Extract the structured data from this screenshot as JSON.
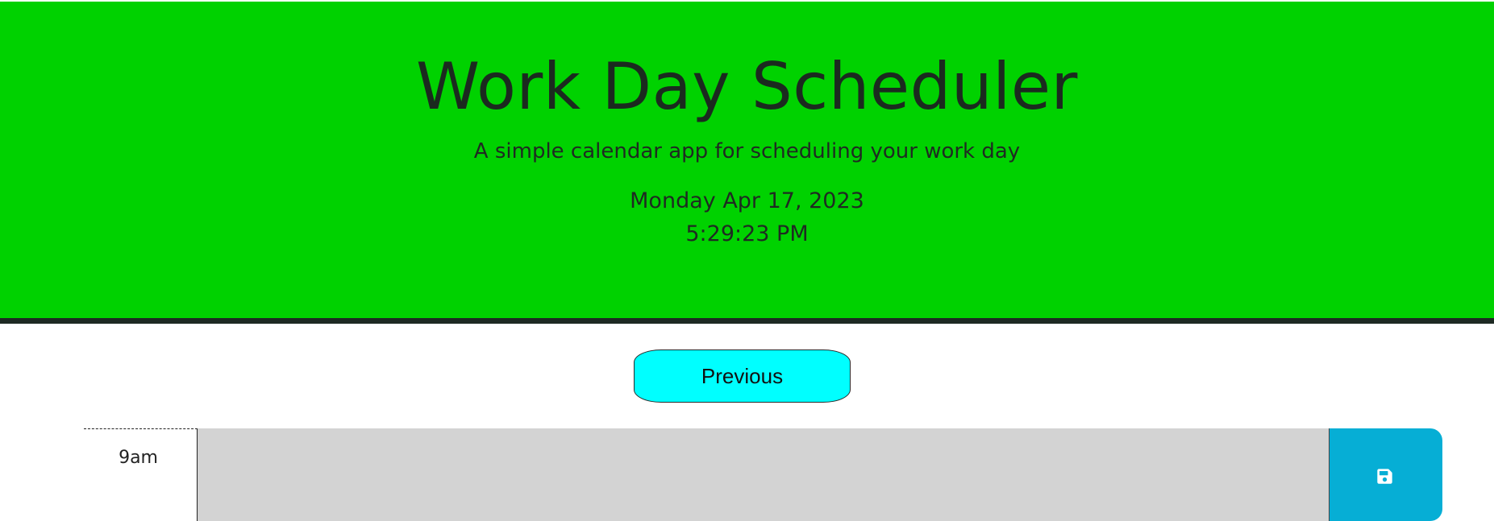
{
  "header": {
    "title": "Work Day Scheduler",
    "subtitle": "A simple calendar app for scheduling your work day",
    "date": "Monday Apr 17, 2023",
    "time": "5:29:23 PM"
  },
  "nav": {
    "previous_label": "Previous"
  },
  "rows": [
    {
      "hour": "9am",
      "description": "",
      "save_icon": "floppy-disk-icon"
    }
  ],
  "colors": {
    "header_bg": "#00d200",
    "header_border": "#1e2a23",
    "previous_bg": "#00ffff",
    "row_past_bg": "#d3d3d3",
    "save_bg": "#06aed5"
  }
}
